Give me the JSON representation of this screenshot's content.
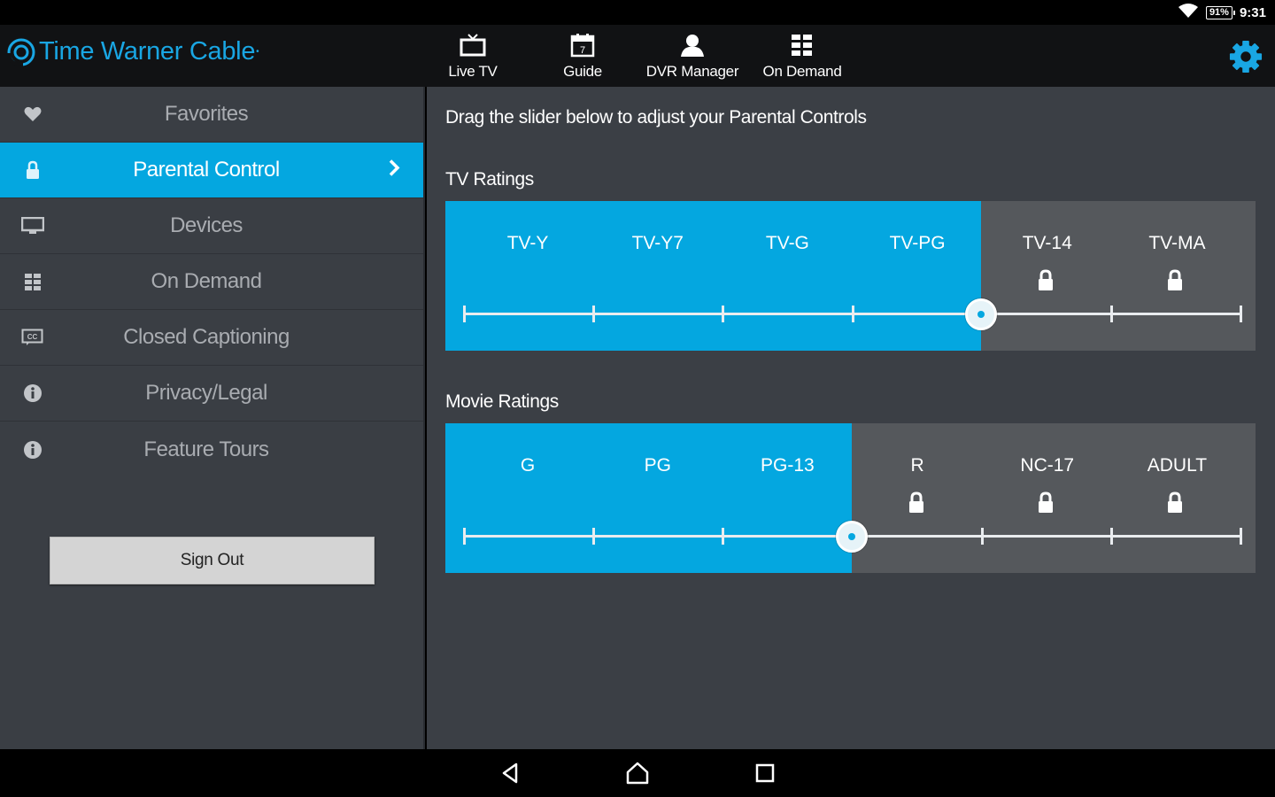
{
  "status_bar": {
    "battery": "91%",
    "time": "9:31"
  },
  "header": {
    "logo_text": "Time Warner Cable",
    "nav": [
      {
        "label": "Live TV",
        "icon": "tv-icon"
      },
      {
        "label": "Guide",
        "icon": "calendar-icon"
      },
      {
        "label": "DVR Manager",
        "icon": "person-icon"
      },
      {
        "label": "On Demand",
        "icon": "grid-icon"
      }
    ],
    "calendar_day": "7"
  },
  "sidebar": {
    "items": [
      {
        "label": "Favorites",
        "icon": "heart-icon",
        "active": false
      },
      {
        "label": "Parental Control",
        "icon": "lock-icon",
        "active": true
      },
      {
        "label": "Devices",
        "icon": "monitor-icon",
        "active": false
      },
      {
        "label": "On Demand",
        "icon": "grid-icon",
        "active": false
      },
      {
        "label": "Closed Captioning",
        "icon": "cc-icon",
        "active": false
      },
      {
        "label": "Privacy/Legal",
        "icon": "info-icon",
        "active": false
      },
      {
        "label": "Feature Tours",
        "icon": "info-icon",
        "active": false
      }
    ],
    "sign_out_label": "Sign Out"
  },
  "main": {
    "instruction": "Drag the slider below to adjust your Parental Controls",
    "tv": {
      "title": "TV Ratings",
      "ratings": [
        "TV-Y",
        "TV-Y7",
        "TV-G",
        "TV-PG",
        "TV-14",
        "TV-MA"
      ],
      "allowed_count": 4,
      "locked": [
        "TV-14",
        "TV-MA"
      ]
    },
    "movie": {
      "title": "Movie Ratings",
      "ratings": [
        "G",
        "PG",
        "PG-13",
        "R",
        "NC-17",
        "ADULT"
      ],
      "allowed_count": 3,
      "locked": [
        "R",
        "NC-17",
        "ADULT"
      ]
    }
  },
  "colors": {
    "accent": "#04a7e0",
    "sidebar_bg": "#3a3e44",
    "locked_bg": "#55585c"
  }
}
